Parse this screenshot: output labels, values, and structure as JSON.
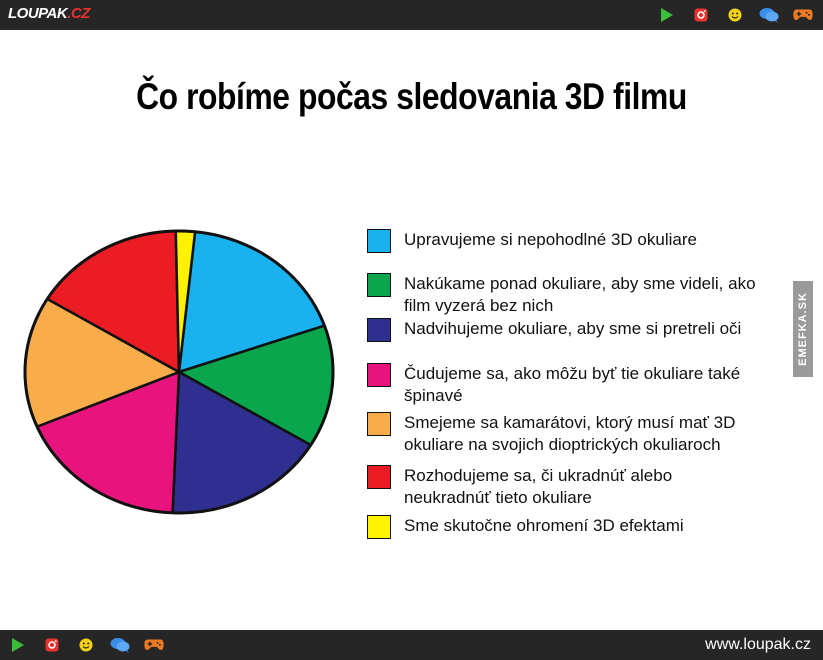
{
  "header": {
    "logo_main": "LOUPAK",
    "logo_accent": ".CZ"
  },
  "footer": {
    "site": "www.loupak.cz"
  },
  "watermark": "EMEFKA.SK",
  "icons": [
    "play-icon",
    "instagram-icon",
    "smiley-icon",
    "chat-icon",
    "gamepad-icon"
  ],
  "chart_data": {
    "type": "pie",
    "title": "Čo robíme počas sledovania 3D filmu",
    "legend_position": "right",
    "slices": [
      {
        "label": "Upravujeme si nepohodlné 3D okuliare",
        "value": 18,
        "color": "#1ab2ee"
      },
      {
        "label": "Nakúkame ponad okuliare, aby sme videli, ako film vyzerá bez nich",
        "value": 14,
        "color": "#0aa64e"
      },
      {
        "label": "Nadvihujeme okuliare, aby sme si pretreli oči",
        "value": 17,
        "color": "#2e2f8f"
      },
      {
        "label": "Čudujeme sa, ako môžu byť tie okuliare také špinavé",
        "value": 18,
        "color": "#e9137d"
      },
      {
        "label": "Smejeme sa kamarátovi, ktorý musí mať 3D okuliare na svojich dioptrických okuliaroch",
        "value": 15,
        "color": "#f9ac4a"
      },
      {
        "label": "Rozhodujeme sa, či ukradnúť alebo neukradnúť tieto okuliare",
        "value": 16,
        "color": "#ec1c24"
      },
      {
        "label": "Sme skutočne ohromení 3D efektami",
        "value": 2,
        "color": "#fff200"
      }
    ]
  }
}
